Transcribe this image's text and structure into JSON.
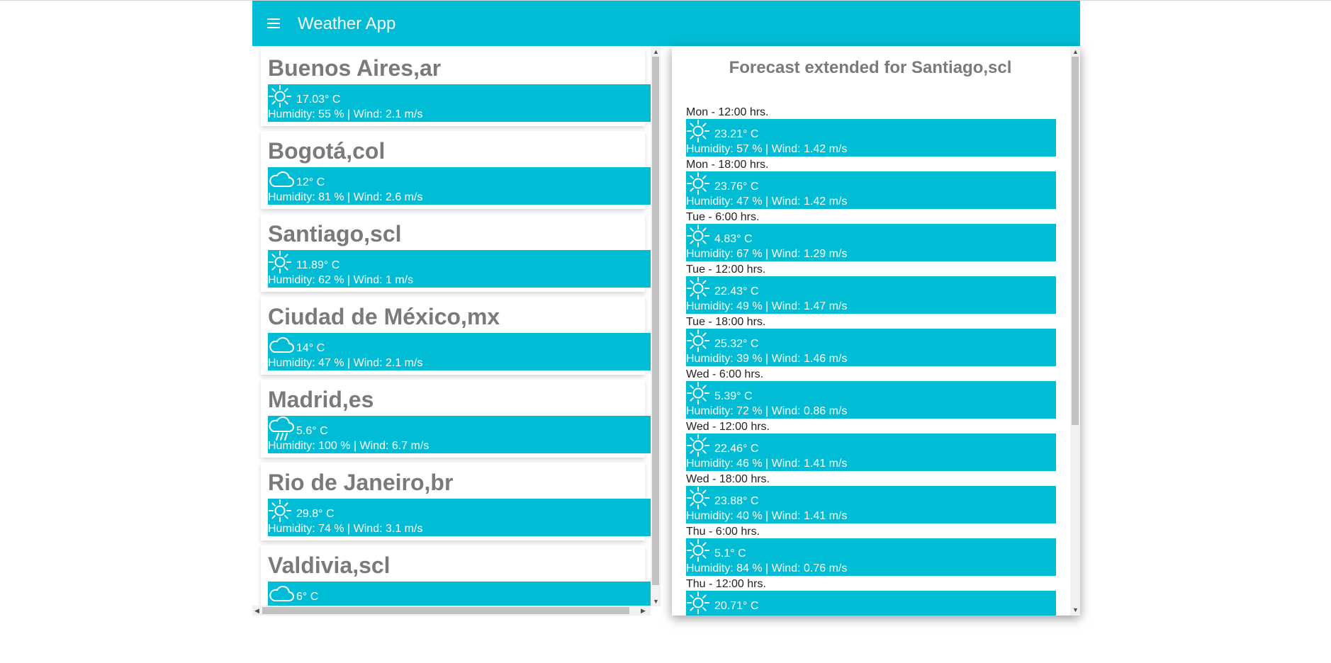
{
  "app": {
    "title": "Weather App"
  },
  "icons": {
    "menu": "menu-icon",
    "sunny": "sun-icon",
    "cloudy": "cloud-icon",
    "rain": "rain-icon"
  },
  "colors": {
    "primary": "#00bcd4",
    "city_text": "#7a7a7a"
  },
  "cities": [
    {
      "name": "Buenos Aires,ar",
      "icon": "sun",
      "temp": "17.03° C",
      "details": "Humidity: 55 % | Wind: 2.1 m/s"
    },
    {
      "name": "Bogotá,col",
      "icon": "cloud",
      "temp": "12° C",
      "details": "Humidity: 81 % | Wind: 2.6 m/s"
    },
    {
      "name": "Santiago,scl",
      "icon": "sun",
      "temp": "11.89° C",
      "details": "Humidity: 62 % | Wind: 1 m/s"
    },
    {
      "name": "Ciudad de México,mx",
      "icon": "cloud",
      "temp": "14° C",
      "details": "Humidity: 47 % | Wind: 2.1 m/s"
    },
    {
      "name": "Madrid,es",
      "icon": "rain",
      "temp": "5.6° C",
      "details": "Humidity: 100 % | Wind: 6.7 m/s"
    },
    {
      "name": "Rio de Janeiro,br",
      "icon": "sun",
      "temp": "29.8° C",
      "details": "Humidity: 74 % | Wind: 3.1 m/s"
    },
    {
      "name": "Valdivia,scl",
      "icon": "cloud",
      "temp": "6° C",
      "details": ""
    }
  ],
  "forecast": {
    "title": "Forecast extended for Santiago,scl",
    "items": [
      {
        "when": "Mon - 12:00 hrs.",
        "icon": "sun",
        "temp": "23.21° C",
        "details": "Humidity: 57 % | Wind: 1.42 m/s"
      },
      {
        "when": "Mon - 18:00 hrs.",
        "icon": "sun",
        "temp": "23.76° C",
        "details": "Humidity: 47 % | Wind: 1.42 m/s"
      },
      {
        "when": "Tue - 6:00 hrs.",
        "icon": "sun",
        "temp": "4.83° C",
        "details": "Humidity: 67 % | Wind: 1.29 m/s"
      },
      {
        "when": "Tue - 12:00 hrs.",
        "icon": "sun",
        "temp": "22.43° C",
        "details": "Humidity: 49 % | Wind: 1.47 m/s"
      },
      {
        "when": "Tue - 18:00 hrs.",
        "icon": "sun",
        "temp": "25.32° C",
        "details": "Humidity: 39 % | Wind: 1.46 m/s"
      },
      {
        "when": "Wed - 6:00 hrs.",
        "icon": "sun",
        "temp": "5.39° C",
        "details": "Humidity: 72 % | Wind: 0.86 m/s"
      },
      {
        "when": "Wed - 12:00 hrs.",
        "icon": "sun",
        "temp": "22.46° C",
        "details": "Humidity: 46 % | Wind: 1.41 m/s"
      },
      {
        "when": "Wed - 18:00 hrs.",
        "icon": "sun",
        "temp": "23.88° C",
        "details": "Humidity: 40 % | Wind: 1.41 m/s"
      },
      {
        "when": "Thu - 6:00 hrs.",
        "icon": "sun",
        "temp": "5.1° C",
        "details": "Humidity: 84 % | Wind: 0.76 m/s"
      },
      {
        "when": "Thu - 12:00 hrs.",
        "icon": "sun",
        "temp": "20.71° C",
        "details": ""
      }
    ]
  }
}
